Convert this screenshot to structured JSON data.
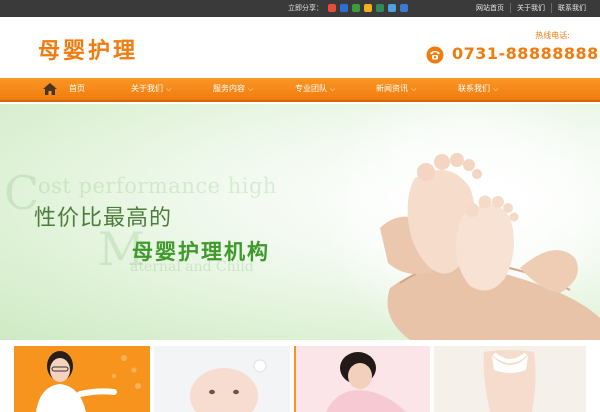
{
  "topbar": {
    "share_label": "立即分享：",
    "share_icons": [
      {
        "name": "qzone-icon",
        "color": "#e84a3c"
      },
      {
        "name": "renren-icon",
        "color": "#2d6fd1"
      },
      {
        "name": "qq-icon",
        "color": "#3a9d3a"
      },
      {
        "name": "favorite-icon",
        "color": "#f2b01e"
      },
      {
        "name": "douban-icon",
        "color": "#2e8b57"
      },
      {
        "name": "tencent-weibo-icon",
        "color": "#4d9fe0"
      },
      {
        "name": "plus-icon",
        "color": "#3b7bd6"
      }
    ],
    "links": [
      "网站首页",
      "关于我们",
      "联系我们"
    ]
  },
  "header": {
    "logo": "母婴护理",
    "hotline_label": "热线电话:",
    "hotline_number": "0731-88888888"
  },
  "nav": {
    "items": [
      {
        "label": "首页",
        "has_dropdown": false
      },
      {
        "label": "关于我们",
        "has_dropdown": true
      },
      {
        "label": "服务内容",
        "has_dropdown": true
      },
      {
        "label": "专业团队",
        "has_dropdown": true
      },
      {
        "label": "新闻资讯",
        "has_dropdown": true
      },
      {
        "label": "联系我们",
        "has_dropdown": true
      }
    ],
    "dropdown_glyph": "⌵"
  },
  "banner": {
    "ghost_line_1": "ost performance high",
    "ghost_C": "C",
    "ghost_M": "M",
    "ghost_line_2": "aternal and Child",
    "slogan_1": "性价比最高的",
    "slogan_2": "母婴护理机构"
  },
  "colors": {
    "brand_orange": "#f07c10",
    "topbar_bg": "#3a3a3a",
    "slogan_green": "#3f9a2c"
  }
}
